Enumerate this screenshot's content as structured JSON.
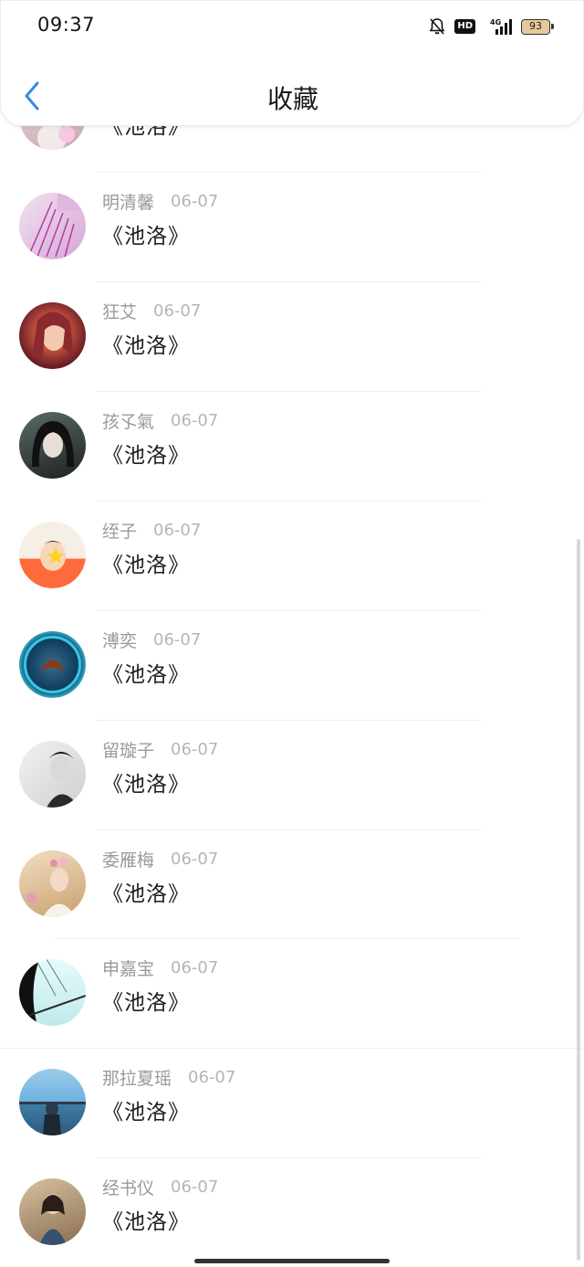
{
  "header": {
    "time": "09:37",
    "title": "收藏",
    "hd": "HD",
    "network": "4G",
    "battery": "93"
  },
  "favorites": [
    {
      "name": "",
      "date": "",
      "title": "《池洛》",
      "avatar_colors": [
        "#e9ddd6",
        "#c9a7b0"
      ]
    },
    {
      "name": "明清馨",
      "date": "06-07",
      "title": "《池洛》",
      "avatar_colors": [
        "#f0e2f0",
        "#b23aa8"
      ]
    },
    {
      "name": "狂艾",
      "date": "06-07",
      "title": "《池洛》",
      "avatar_colors": [
        "#6a1d26",
        "#f0a36a"
      ]
    },
    {
      "name": "孩孓氣",
      "date": "06-07",
      "title": "《池洛》",
      "avatar_colors": [
        "#1d2222",
        "#5b6b66"
      ]
    },
    {
      "name": "绖子",
      "date": "06-07",
      "title": "《池洛》",
      "avatar_colors": [
        "#ff6a3a",
        "#f6d7b8"
      ]
    },
    {
      "name": "溥奕",
      "date": "06-07",
      "title": "《池洛》",
      "avatar_colors": [
        "#0d3c5d",
        "#3ac5e4"
      ]
    },
    {
      "name": "留璇子",
      "date": "06-07",
      "title": "《池洛》",
      "avatar_colors": [
        "#e6e6e6",
        "#2b2b2b"
      ]
    },
    {
      "name": "委雁梅",
      "date": "06-07",
      "title": "《池洛》",
      "avatar_colors": [
        "#f1dfc0",
        "#a87f4c"
      ]
    },
    {
      "name": "申嘉宝",
      "date": "06-07",
      "title": "《池洛》",
      "avatar_colors": [
        "#c8f2f2",
        "#101010"
      ]
    },
    {
      "name": "那拉夏瑶",
      "date": "06-07",
      "title": "《池洛》",
      "avatar_colors": [
        "#6db2e0",
        "#2d3a47"
      ]
    },
    {
      "name": "经书仪",
      "date": "06-07",
      "title": "《池洛》",
      "avatar_colors": [
        "#c2a78a",
        "#36506f"
      ]
    }
  ],
  "theme": {
    "accent": "#1e90ff"
  }
}
